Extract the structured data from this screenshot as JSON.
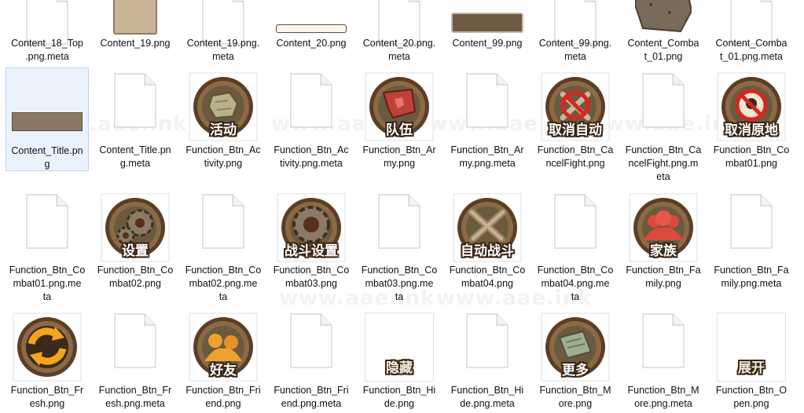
{
  "watermark": "www.aae.ink",
  "rows": [
    {
      "items": [
        {
          "name": "Content_18_Top.png.meta",
          "lines": [
            "Content_18_Top",
            ".png.meta"
          ],
          "kind": "file"
        },
        {
          "name": "Content_19.png",
          "lines": [
            "Content_19.png"
          ],
          "kind": "panel-tan"
        },
        {
          "name": "Content_19.png.meta",
          "lines": [
            "Content_19.png.",
            "meta"
          ],
          "kind": "file"
        },
        {
          "name": "Content_20.png",
          "lines": [
            "Content_20.png"
          ],
          "kind": "bar-white"
        },
        {
          "name": "Content_20.png.meta",
          "lines": [
            "Content_20.png.",
            "meta"
          ],
          "kind": "file"
        },
        {
          "name": "Content_99.png",
          "lines": [
            "Content_99.png"
          ],
          "kind": "bar-brown"
        },
        {
          "name": "Content_99.png.meta",
          "lines": [
            "Content_99.png.",
            "meta"
          ],
          "kind": "file"
        },
        {
          "name": "Content_Combat_01.png",
          "lines": [
            "Content_Comba",
            "t_01.png"
          ],
          "kind": "panel-dark"
        },
        {
          "name": "Content_Combat_01.png.meta",
          "lines": [
            "Content_Comba",
            "t_01.png.meta"
          ],
          "kind": "file"
        }
      ]
    },
    {
      "items": [
        {
          "name": "Content_Title.png",
          "lines": [
            "Content_Title.pn",
            "g"
          ],
          "kind": "bar-stone",
          "selected": true
        },
        {
          "name": "Content_Title.png.meta",
          "lines": [
            "Content_Title.pn",
            "g.meta"
          ],
          "kind": "file"
        },
        {
          "name": "Function_Btn_Activity.png",
          "lines": [
            "Function_Btn_Ac",
            "tivity.png"
          ],
          "kind": "btn",
          "icon": "stone",
          "caption": "活动",
          "inner": "#6b5a3d"
        },
        {
          "name": "Function_Btn_Activity.png.meta",
          "lines": [
            "Function_Btn_Ac",
            "tivity.png.meta"
          ],
          "kind": "file"
        },
        {
          "name": "Function_Btn_Army.png",
          "lines": [
            "Function_Btn_Ar",
            "my.png"
          ],
          "kind": "btn",
          "icon": "flag",
          "caption": "队伍",
          "inner": "#6b5a3d"
        },
        {
          "name": "Function_Btn_Army.png.meta",
          "lines": [
            "Function_Btn_Ar",
            "my.png.meta"
          ],
          "kind": "file"
        },
        {
          "name": "Function_Btn_CancelFight.png",
          "lines": [
            "Function_Btn_Ca",
            "ncelFight.png"
          ],
          "kind": "btn",
          "icon": "cancel-swords",
          "caption": "取消自动",
          "inner": "#6b5a3d"
        },
        {
          "name": "Function_Btn_CancelFight.png.meta",
          "lines": [
            "Function_Btn_Ca",
            "ncelFight.png.m",
            "eta"
          ],
          "kind": "file"
        },
        {
          "name": "Function_Btn_Combat01.png",
          "lines": [
            "Function_Btn_Co",
            "mbat01.png"
          ],
          "kind": "btn",
          "icon": "cancel-pin",
          "caption": "取消原地",
          "inner": "#6b5a3d"
        }
      ]
    },
    {
      "items": [
        {
          "name": "Function_Btn_Combat01.png.meta",
          "lines": [
            "Function_Btn_Co",
            "mbat01.png.me",
            "ta"
          ],
          "kind": "file"
        },
        {
          "name": "Function_Btn_Combat02.png",
          "lines": [
            "Function_Btn_Co",
            "mbat02.png"
          ],
          "kind": "btn",
          "icon": "gears",
          "caption": "设置",
          "inner": "#6b5a3d"
        },
        {
          "name": "Function_Btn_Combat02.png.meta",
          "lines": [
            "Function_Btn_Co",
            "mbat02.png.me",
            "ta"
          ],
          "kind": "file"
        },
        {
          "name": "Function_Btn_Combat03.png",
          "lines": [
            "Function_Btn_Co",
            "mbat03.png"
          ],
          "kind": "btn",
          "icon": "gear",
          "caption": "战斗设置",
          "inner": "#6b5a3d"
        },
        {
          "name": "Function_Btn_Combat03.png.meta",
          "lines": [
            "Function_Btn_Co",
            "mbat03.png.me",
            "ta"
          ],
          "kind": "file"
        },
        {
          "name": "Function_Btn_Combat04.png",
          "lines": [
            "Function_Btn_Co",
            "mbat04.png"
          ],
          "kind": "btn",
          "icon": "swords",
          "caption": "自动战斗",
          "inner": "#6b5a3d"
        },
        {
          "name": "Function_Btn_Combat04.png.meta",
          "lines": [
            "Function_Btn_Co",
            "mbat04.png.me",
            "ta"
          ],
          "kind": "file"
        },
        {
          "name": "Function_Btn_Family.png",
          "lines": [
            "Function_Btn_Fa",
            "mily.png"
          ],
          "kind": "btn",
          "icon": "people-red",
          "caption": "家族",
          "inner": "#6b5a3d"
        },
        {
          "name": "Function_Btn_Family.png.meta",
          "lines": [
            "Function_Btn_Fa",
            "mily.png.meta"
          ],
          "kind": "file"
        }
      ]
    },
    {
      "items": [
        {
          "name": "Function_Btn_Fresh.png",
          "lines": [
            "Function_Btn_Fr",
            "esh.png"
          ],
          "kind": "btn",
          "icon": "refresh",
          "caption": "",
          "inner": "#3a2a1c"
        },
        {
          "name": "Function_Btn_Fresh.png.meta",
          "lines": [
            "Function_Btn_Fr",
            "esh.png.meta"
          ],
          "kind": "file"
        },
        {
          "name": "Function_Btn_Friend.png",
          "lines": [
            "Function_Btn_Fri",
            "end.png"
          ],
          "kind": "btn",
          "icon": "people-orange",
          "caption": "好友",
          "inner": "#6b5a3d"
        },
        {
          "name": "Function_Btn_Friend.png.meta",
          "lines": [
            "Function_Btn_Fri",
            "end.png.meta"
          ],
          "kind": "file"
        },
        {
          "name": "Function_Btn_Hide.png",
          "lines": [
            "Function_Btn_Hi",
            "de.png"
          ],
          "kind": "text-only",
          "caption": "隐藏"
        },
        {
          "name": "Function_Btn_Hide.png.meta",
          "lines": [
            "Function_Btn_Hi",
            "de.png.meta"
          ],
          "kind": "file"
        },
        {
          "name": "Function_Btn_More.png",
          "lines": [
            "Function_Btn_M",
            "ore.png"
          ],
          "kind": "btn",
          "icon": "scroll",
          "caption": "更多",
          "inner": "#6b5a3d"
        },
        {
          "name": "Function_Btn_More.png.meta",
          "lines": [
            "Function_Btn_M",
            "ore.png.meta"
          ],
          "kind": "file"
        },
        {
          "name": "Function_Btn_Open.png",
          "lines": [
            "Function_Btn_O",
            "pen.png"
          ],
          "kind": "text-only",
          "caption": "展开"
        }
      ]
    }
  ]
}
